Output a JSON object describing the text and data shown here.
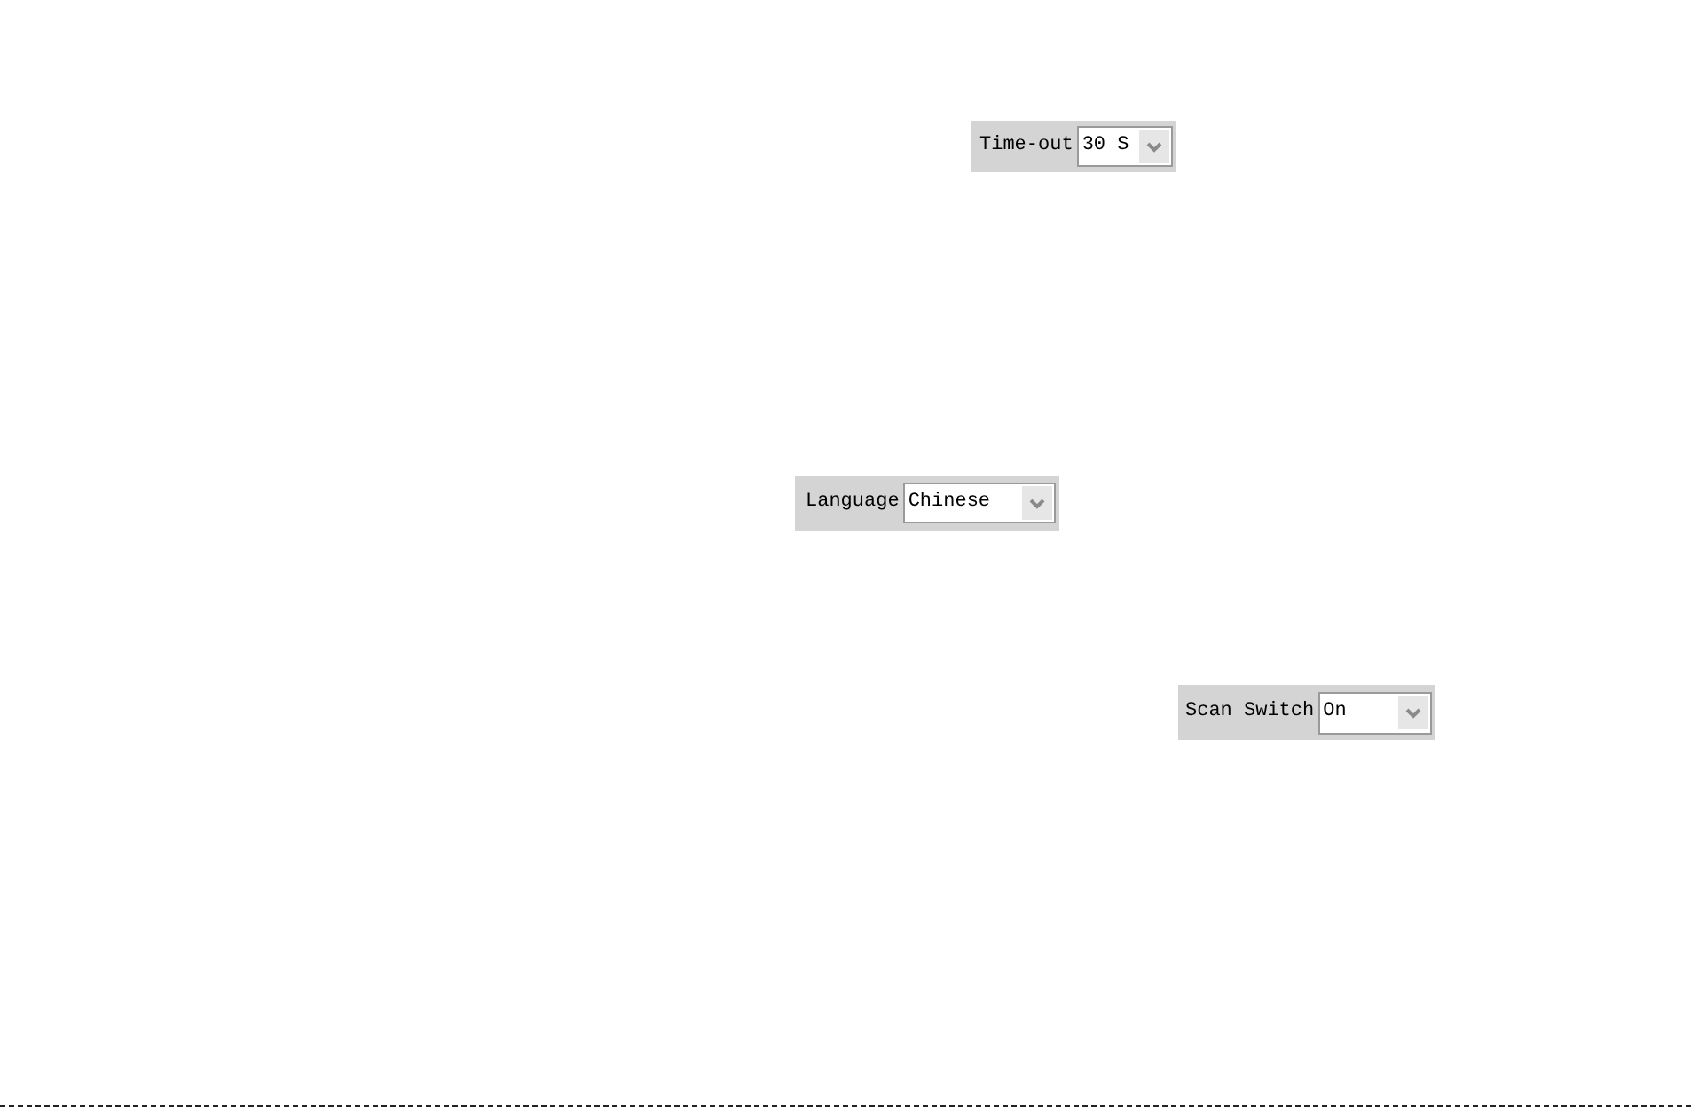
{
  "settings": [
    {
      "label": "Time-out",
      "value": "30 S"
    },
    {
      "label": "Language",
      "value": "Chinese"
    },
    {
      "label": "Scan Switch",
      "value": "On"
    }
  ]
}
